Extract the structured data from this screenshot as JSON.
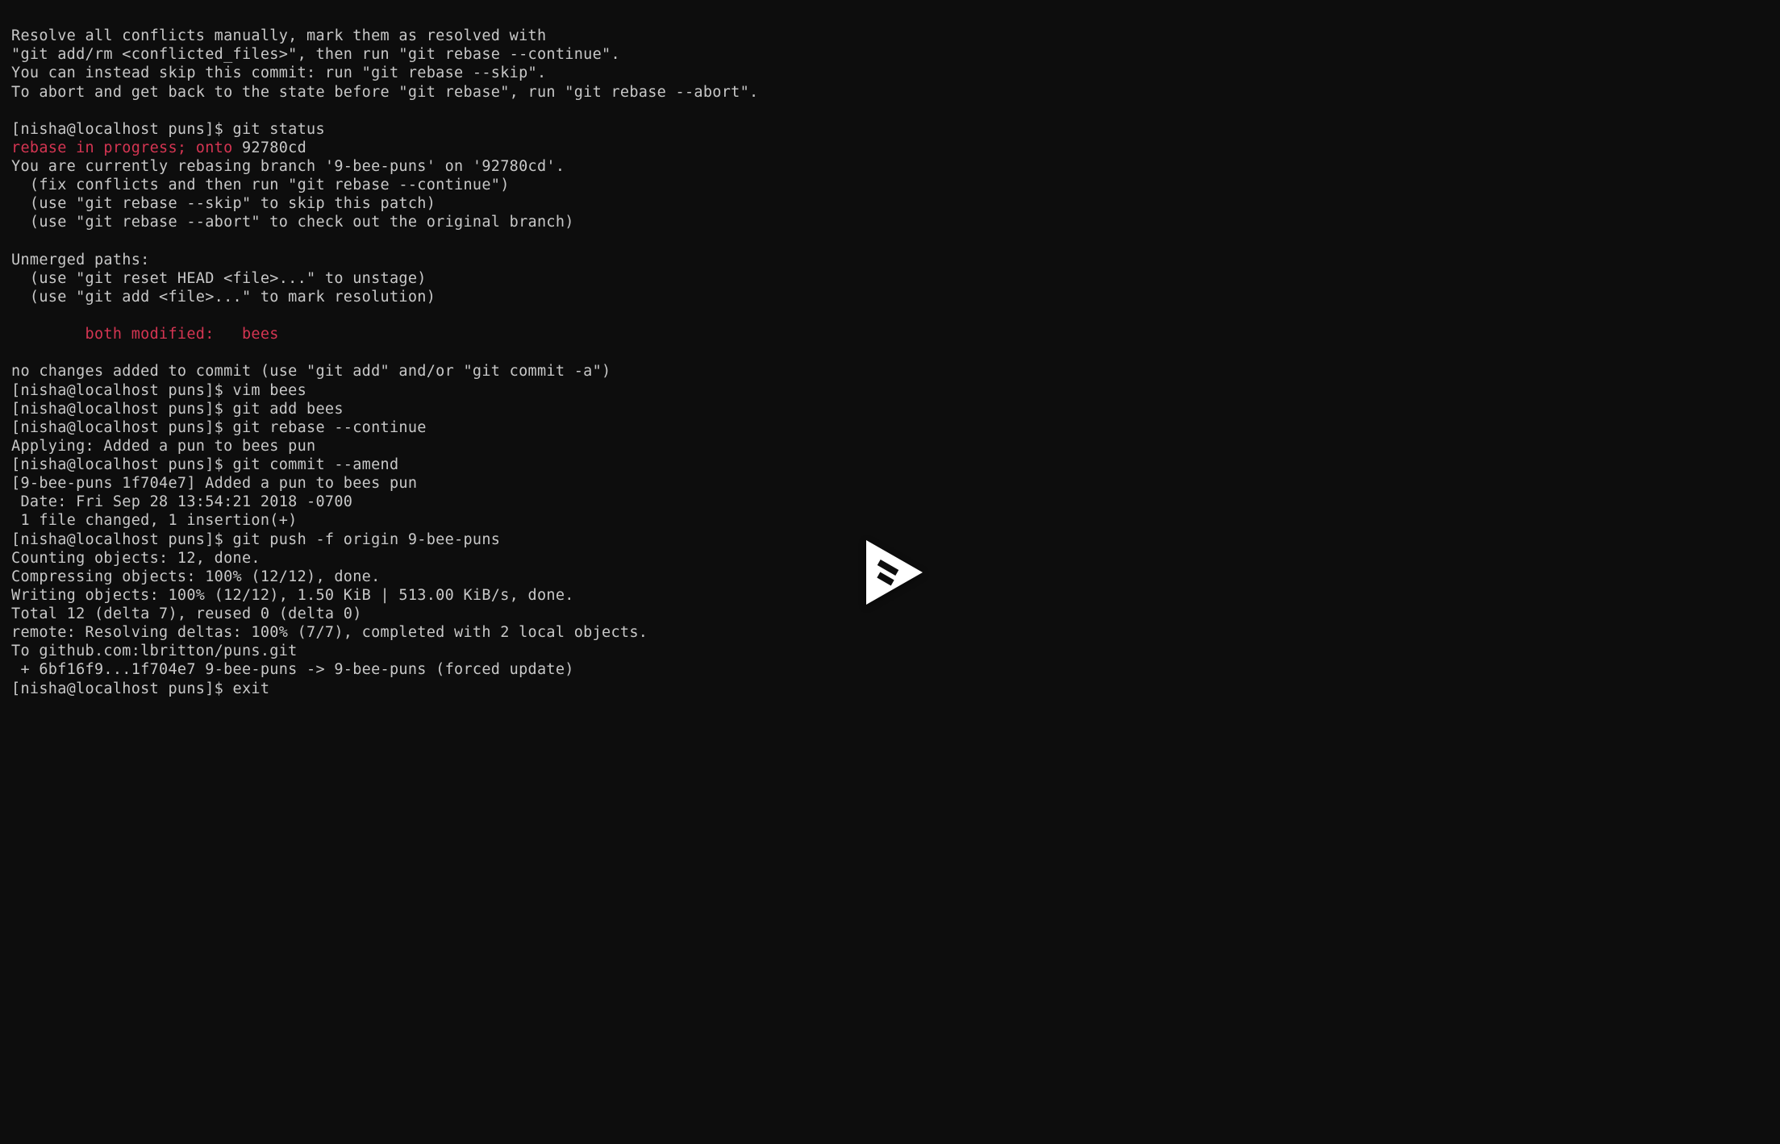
{
  "terminal": {
    "prompt": "[nisha@localhost puns]$ ",
    "lines": {
      "l01": "Resolve all conflicts manually, mark them as resolved with",
      "l02": "\"git add/rm <conflicted_files>\", then run \"git rebase --continue\".",
      "l03": "You can instead skip this commit: run \"git rebase --skip\".",
      "l04": "To abort and get back to the state before \"git rebase\", run \"git rebase --abort\".",
      "l05": "",
      "l06_cmd": "git status",
      "l07_red": "rebase in progress; onto ",
      "l07_rest": "92780cd",
      "l08": "You are currently rebasing branch '9-bee-puns' on '92780cd'.",
      "l09": "  (fix conflicts and then run \"git rebase --continue\")",
      "l10": "  (use \"git rebase --skip\" to skip this patch)",
      "l11": "  (use \"git rebase --abort\" to check out the original branch)",
      "l12": "",
      "l13": "Unmerged paths:",
      "l14": "  (use \"git reset HEAD <file>...\" to unstage)",
      "l15": "  (use \"git add <file>...\" to mark resolution)",
      "l16": "",
      "l17_red": "        both modified:   bees",
      "l18": "",
      "l19": "no changes added to commit (use \"git add\" and/or \"git commit -a\")",
      "l20_cmd": "vim bees",
      "l21_cmd": "git add bees",
      "l22_cmd": "git rebase --continue",
      "l23": "Applying: Added a pun to bees pun",
      "l24_cmd": "git commit --amend",
      "l25": "[9-bee-puns 1f704e7] Added a pun to bees pun",
      "l26": " Date: Fri Sep 28 13:54:21 2018 -0700",
      "l27": " 1 file changed, 1 insertion(+)",
      "l28_cmd": "git push -f origin 9-bee-puns",
      "l29": "Counting objects: 12, done.",
      "l30": "Compressing objects: 100% (12/12), done.",
      "l31": "Writing objects: 100% (12/12), 1.50 KiB | 513.00 KiB/s, done.",
      "l32": "Total 12 (delta 7), reused 0 (delta 0)",
      "l33": "remote: Resolving deltas: 100% (7/7), completed with 2 local objects.",
      "l34": "To github.com:lbritton/puns.git",
      "l35": " + 6bf16f9...1f704e7 9-bee-puns -> 9-bee-puns (forced update)",
      "l36_cmd": "exit"
    }
  },
  "overlay": {
    "icon_name": "play-icon"
  }
}
